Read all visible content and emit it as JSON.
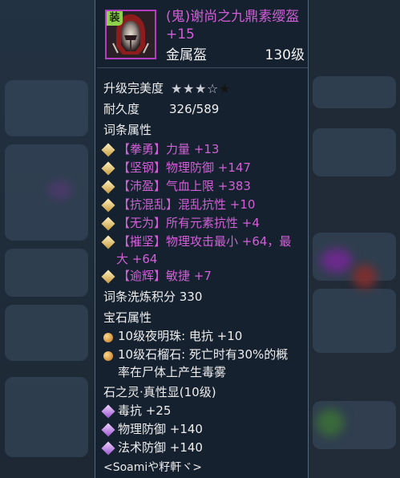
{
  "item": {
    "badge": "装",
    "name": "(鬼)谢尚之九鼎素缨盔 +15",
    "type": "金属盔",
    "level": "130级"
  },
  "upgrade": {
    "label": "升级完美度",
    "stars_filled": 3,
    "stars_total": 5
  },
  "durability": {
    "label": "耐久度",
    "value": "326/589"
  },
  "affix": {
    "header": "词条属性",
    "items": [
      {
        "text": "【拳勇】力量 +13"
      },
      {
        "text": "【坚钢】物理防御 +147"
      },
      {
        "text": "【沛盈】气血上限 +383"
      },
      {
        "text": "【抗混乱】混乱抗性 +10"
      },
      {
        "text": "【无为】所有元素抗性 +4"
      },
      {
        "text": "【摧坚】物理攻击最小 +64，最",
        "cont": "大 +64"
      },
      {
        "text": "【逾辉】敏捷 +7"
      }
    ],
    "refine": "词条洗炼积分 330"
  },
  "gems": {
    "header": "宝石属性",
    "items": [
      {
        "text": "10级夜明珠: 电抗 +10"
      },
      {
        "text": "10级石榴石: 死亡时有30%的概",
        "cont": "率在尸体上产生毒雾"
      }
    ]
  },
  "spirit": {
    "header": "石之灵·真性显(10级)",
    "items": [
      {
        "text": "毒抗 +25"
      },
      {
        "text": "物理防御 +140"
      },
      {
        "text": "法术防御 +140"
      }
    ]
  },
  "signature": "<Soamiや籽軒ヾ>",
  "colors": {
    "name": "#d05ed6",
    "affix": "#d160d6",
    "text": "#eeeeee",
    "border": "#b23ec2"
  },
  "icons": [
    "helmet-icon",
    "star-icon",
    "gold-diamond-icon",
    "gold-orb-icon",
    "purple-diamond-icon"
  ]
}
